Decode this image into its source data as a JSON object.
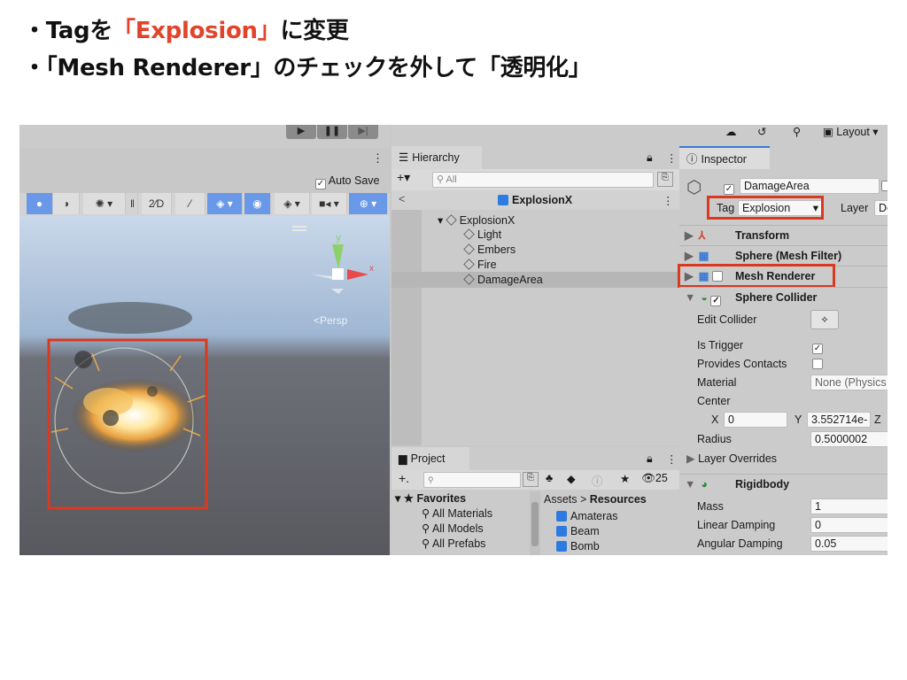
{
  "slide": {
    "bullet1": {
      "prefix": "・Tagを",
      "highlight": "「Explosion」",
      "suffix": "に変更"
    },
    "bullet2": {
      "text": "・「Mesh Renderer」のチェックを外して「透明化」"
    }
  },
  "scene": {
    "auto_save": "Auto Save",
    "persp": "<Persp",
    "gizmo_y": "y",
    "gizmo_x": "x"
  },
  "hierarchy": {
    "tab": "Hierarchy",
    "search_placeholder": "All",
    "scene": "ExplosionX",
    "root": "ExplosionX",
    "children": [
      "Light",
      "Embers",
      "Fire",
      "DamageArea"
    ]
  },
  "project": {
    "tab": "Project",
    "favorites": "Favorites",
    "fav_items": [
      "All Materials",
      "All Models",
      "All Prefabs"
    ],
    "breadcrumb_assets": "Assets",
    "breadcrumb_sep": ">",
    "breadcrumb_resources": "Resources",
    "assets": [
      "Amateras",
      "Beam",
      "Bomb"
    ],
    "visible_count": "25"
  },
  "toolbar": {
    "layout": "Layout"
  },
  "inspector": {
    "tab": "Inspector",
    "object_name": "DamageArea",
    "tag_label": "Tag",
    "tag_value": "Explosion",
    "layer_label": "Layer",
    "layer_value": "De",
    "components": {
      "transform": "Transform",
      "mesh_filter": "Sphere (Mesh Filter)",
      "mesh_renderer": "Mesh Renderer",
      "sphere_collider": "Sphere Collider",
      "rigidbody": "Rigidbody"
    },
    "collider": {
      "edit_collider": "Edit Collider",
      "is_trigger": "Is Trigger",
      "provides_contacts": "Provides Contacts",
      "material": "Material",
      "material_value": "None (Physics",
      "center": "Center",
      "x_label": "X",
      "x_value": "0",
      "y_label": "Y",
      "y_value": "3.552714e-",
      "z_label": "Z",
      "radius": "Radius",
      "radius_value": "0.5000002",
      "layer_overrides": "Layer Overrides"
    },
    "rigidbody": {
      "mass": "Mass",
      "mass_value": "1",
      "linear_damping": "Linear Damping",
      "linear_damping_value": "0",
      "angular_damping": "Angular Damping",
      "angular_damping_value": "0.05"
    }
  },
  "colors": {
    "accent": "#e2442b",
    "blue": "#2b7be2",
    "highlight_box": "#d8391f"
  }
}
